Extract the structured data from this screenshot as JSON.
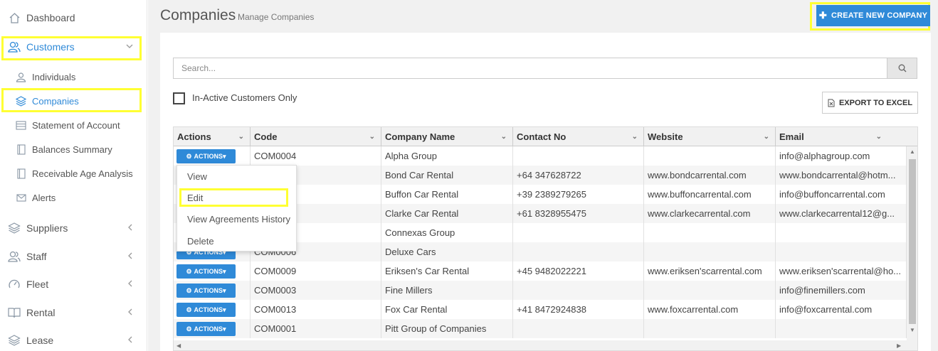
{
  "sidebar": {
    "dashboard": "Dashboard",
    "customers": "Customers",
    "individuals": "Individuals",
    "companies": "Companies",
    "statement": "Statement of Account",
    "balances": "Balances Summary",
    "receivable": "Receivable Age Analysis",
    "alerts": "Alerts",
    "suppliers": "Suppliers",
    "staff": "Staff",
    "fleet": "Fleet",
    "rental": "Rental",
    "lease": "Lease"
  },
  "header": {
    "title": "Companies",
    "subtitle": "Manage Companies",
    "create_label": "CREATE NEW COMPANY"
  },
  "search": {
    "placeholder": "Search..."
  },
  "filter": {
    "inactive_label": "In-Active Customers Only"
  },
  "export": {
    "label": "EXPORT TO EXCEL"
  },
  "table": {
    "columns": [
      "Actions",
      "Code",
      "Company Name",
      "Contact No",
      "Website",
      "Email"
    ],
    "action_label": "ACTIONS",
    "rows": [
      {
        "code": "COM0004",
        "name": "Alpha Group",
        "contact": "",
        "website": "",
        "email": "info@alphagroup.com"
      },
      {
        "code": "",
        "name": "Bond Car Rental",
        "contact": "+64 347628722",
        "website": "www.bondcarrental.com",
        "email": "www.bondcarrental@hotm..."
      },
      {
        "code": "",
        "name": "Buffon Car Rental",
        "contact": "+39 2389279265",
        "website": "www.buffoncarrental.com",
        "email": "info@buffoncarrental.com"
      },
      {
        "code": "",
        "name": "Clarke Car Rental",
        "contact": "+61 8328955475",
        "website": "www.clarkecarrental.com",
        "email": "www.clarkecarrental12@g..."
      },
      {
        "code": "",
        "name": "Connexas Group",
        "contact": "",
        "website": "",
        "email": ""
      },
      {
        "code": "COM0006",
        "name": "Deluxe Cars",
        "contact": "",
        "website": "",
        "email": ""
      },
      {
        "code": "COM0009",
        "name": "Eriksen's Car Rental",
        "contact": "+45 9482022221",
        "website": "www.eriksen'scarrental.com",
        "email": "www.eriksen'scarrental@ho..."
      },
      {
        "code": "COM0003",
        "name": "Fine Millers",
        "contact": "",
        "website": "",
        "email": "info@finemillers.com"
      },
      {
        "code": "COM0013",
        "name": "Fox Car Rental",
        "contact": "+41 8472924838",
        "website": "www.foxcarrental.com",
        "email": "info@foxcarrental.com"
      },
      {
        "code": "COM0001",
        "name": "Pitt Group of Companies",
        "contact": "",
        "website": "",
        "email": ""
      }
    ]
  },
  "dropdown": {
    "items": [
      "View",
      "Edit",
      "View Agreements History",
      "Delete"
    ]
  },
  "colors": {
    "accent": "#2f8ad8",
    "highlight": "#ffff33"
  }
}
